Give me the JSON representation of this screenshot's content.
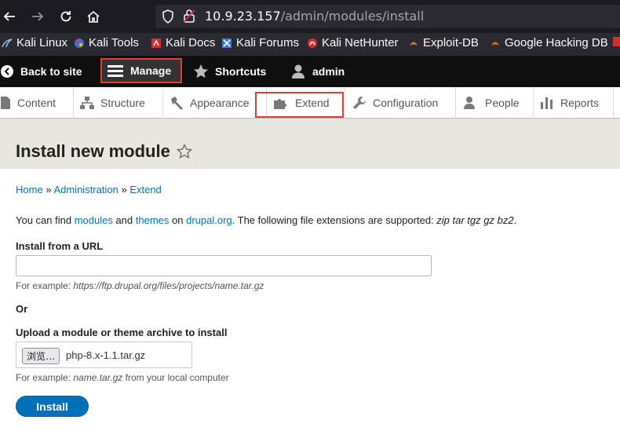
{
  "browser": {
    "url_host": "10.9.23.157",
    "url_path": "/admin/modules/install",
    "bookmarks": [
      {
        "label": "Kali Linux",
        "icon": "kali-dragon-icon"
      },
      {
        "label": "Kali Tools",
        "icon": "kali-tools-icon"
      },
      {
        "label": "Kali Docs",
        "icon": "kali-docs-icon"
      },
      {
        "label": "Kali Forums",
        "icon": "kali-forums-icon"
      },
      {
        "label": "Kali NetHunter",
        "icon": "nethunter-icon"
      },
      {
        "label": "Exploit-DB",
        "icon": "exploit-db-icon"
      },
      {
        "label": "Google Hacking DB",
        "icon": "ghdb-icon"
      }
    ]
  },
  "toolbar": {
    "back_label": "Back to site",
    "manage_label": "Manage",
    "shortcuts_label": "Shortcuts",
    "user_label": "admin"
  },
  "tray": {
    "items": [
      {
        "label": "Content",
        "icon": "content-icon"
      },
      {
        "label": "Structure",
        "icon": "structure-icon"
      },
      {
        "label": "Appearance",
        "icon": "appearance-icon"
      },
      {
        "label": "Extend",
        "icon": "extend-icon"
      },
      {
        "label": "Configuration",
        "icon": "configuration-icon"
      },
      {
        "label": "People",
        "icon": "people-icon"
      },
      {
        "label": "Reports",
        "icon": "reports-icon"
      }
    ]
  },
  "page": {
    "title": "Install new module",
    "breadcrumb": [
      "Home",
      "Administration",
      "Extend"
    ],
    "breadcrumb_sep": "»",
    "intro": {
      "part1": "You can find ",
      "modules_link": "modules",
      "part2": " and ",
      "themes_link": "themes",
      "part3": " on ",
      "drupal_link": "drupal.org",
      "part4": ". The following file extensions are supported: ",
      "extensions": "zip tar tgz gz bz2",
      "part5": "."
    },
    "url_label": "Install from a URL",
    "url_value": "",
    "url_example_prefix": "For example: ",
    "url_example": "https://ftp.drupal.org/files/projects/name.tar.gz",
    "or_label": "Or",
    "upload_label": "Upload a module or theme archive to install",
    "browse_label": "浏览…",
    "file_name": "php-8.x-1.1.tar.gz",
    "upload_example_prefix": "For example: ",
    "upload_example": "name.tar.gz",
    "upload_example_suffix": " from your local computer",
    "install_label": "Install"
  },
  "colors": {
    "link": "#0074bd",
    "install_button": "#0071b8",
    "highlight_box": "#e33b3b",
    "header_bg": "#e7e6df"
  }
}
